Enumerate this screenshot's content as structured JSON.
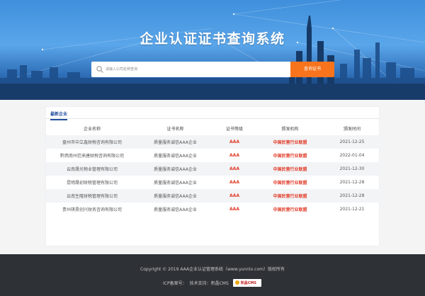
{
  "hero": {
    "title": "企业认证证书查询系统",
    "search_placeholder": "请输入公司名称查询",
    "search_button": "查询证书"
  },
  "section": {
    "tab": "最新企业"
  },
  "table": {
    "headers": [
      "企业名称",
      "证书名称",
      "证书等级",
      "颁发机构",
      "颁发时间"
    ],
    "rows": [
      [
        "盘州市中立鑫财税咨询有限公司",
        "质量服务诚信AAA企业",
        "AAA",
        "中国民营行业联盟",
        "2021-12-25"
      ],
      [
        "黔西南州范来唐财税咨询有限公司",
        "质量服务诚信AAA企业",
        "AAA",
        "中国民营行业联盟",
        "2022-01-04"
      ],
      [
        "云南晟光物业管理有限公司",
        "质量服务诚信AAA企业",
        "AAA",
        "中国民营行业联盟",
        "2021-12-30"
      ],
      [
        "昆明晟初财税管理有限公司",
        "质量服务诚信AAA企业",
        "AAA",
        "中国民营行业联盟",
        "2021-12-28"
      ],
      [
        "云南生隆财税管理有限公司",
        "质量服务诚信AAA企业",
        "AAA",
        "中国民营行业联盟",
        "2021-12-28"
      ],
      [
        "贵州祺昊创兴财务咨询有限公司",
        "质量服务诚信AAA企业",
        "AAA",
        "中国民营行业联盟",
        "2021-12-21"
      ]
    ]
  },
  "footer": {
    "copyright": "Copyright © 2019 AAA企业认证管理系统（www.yunnlx.com）版权所有",
    "icp": "ICP备案号：",
    "support": "技术支持：积晶CMS",
    "logo_text": "积晶CMS"
  },
  "colors": {
    "accent_orange": "#f7741d",
    "tab_blue": "#234e9e",
    "level_red": "#e13d2a",
    "footer_bg": "#2e3135"
  }
}
